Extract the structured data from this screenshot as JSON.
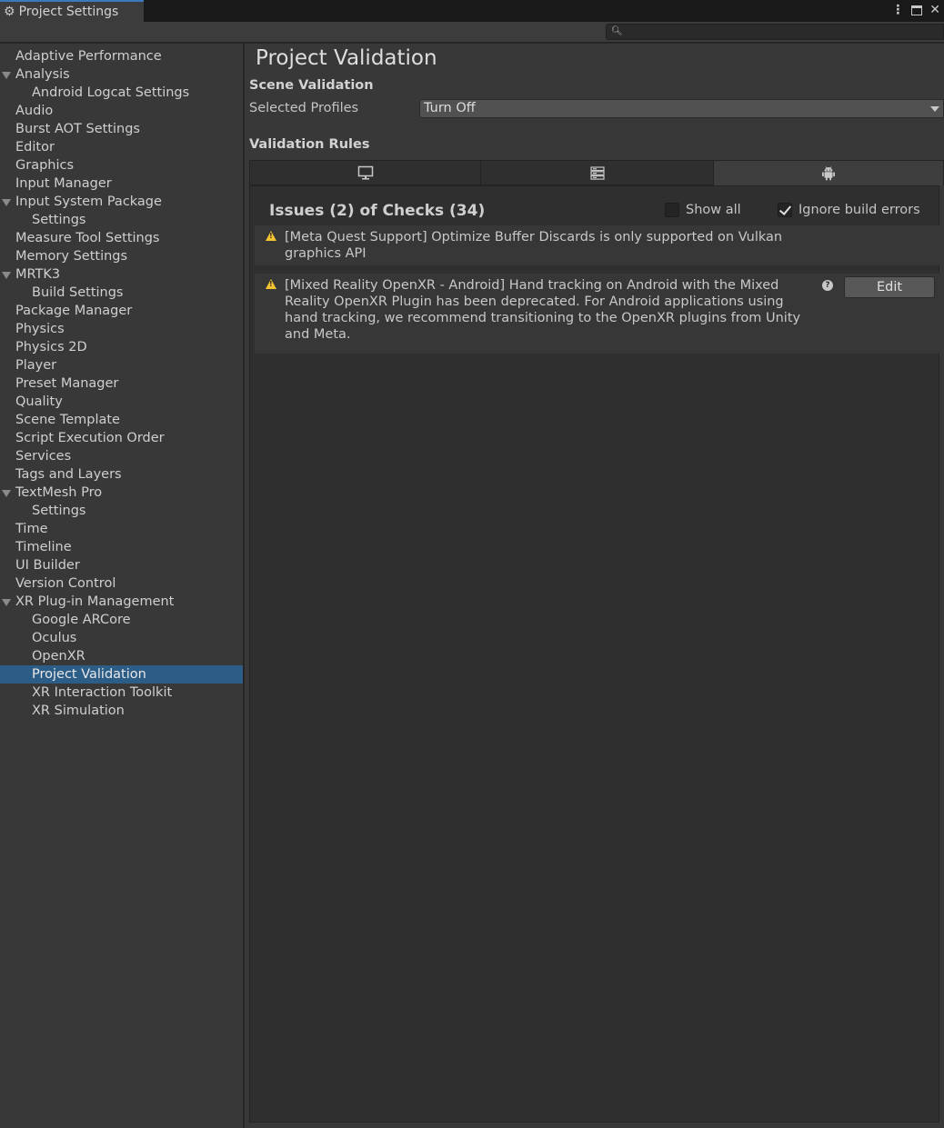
{
  "window": {
    "tab_title": "Project Settings",
    "tab_icon": "gear-icon",
    "controls": [
      "more-options-icon",
      "maximize-icon",
      "close-icon"
    ]
  },
  "search": {
    "placeholder": "",
    "value": ""
  },
  "sidebar": {
    "items": [
      {
        "label": "Adaptive Performance",
        "level": 0,
        "expandable": false
      },
      {
        "label": "Analysis",
        "level": 0,
        "expandable": true
      },
      {
        "label": "Android Logcat Settings",
        "level": 1,
        "expandable": false
      },
      {
        "label": "Audio",
        "level": 0,
        "expandable": false
      },
      {
        "label": "Burst AOT Settings",
        "level": 0,
        "expandable": false
      },
      {
        "label": "Editor",
        "level": 0,
        "expandable": false
      },
      {
        "label": "Graphics",
        "level": 0,
        "expandable": false
      },
      {
        "label": "Input Manager",
        "level": 0,
        "expandable": false
      },
      {
        "label": "Input System Package",
        "level": 0,
        "expandable": true
      },
      {
        "label": "Settings",
        "level": 1,
        "expandable": false
      },
      {
        "label": "Measure Tool Settings",
        "level": 0,
        "expandable": false
      },
      {
        "label": "Memory Settings",
        "level": 0,
        "expandable": false
      },
      {
        "label": "MRTK3",
        "level": 0,
        "expandable": true
      },
      {
        "label": "Build Settings",
        "level": 1,
        "expandable": false
      },
      {
        "label": "Package Manager",
        "level": 0,
        "expandable": false
      },
      {
        "label": "Physics",
        "level": 0,
        "expandable": false
      },
      {
        "label": "Physics 2D",
        "level": 0,
        "expandable": false
      },
      {
        "label": "Player",
        "level": 0,
        "expandable": false
      },
      {
        "label": "Preset Manager",
        "level": 0,
        "expandable": false
      },
      {
        "label": "Quality",
        "level": 0,
        "expandable": false
      },
      {
        "label": "Scene Template",
        "level": 0,
        "expandable": false
      },
      {
        "label": "Script Execution Order",
        "level": 0,
        "expandable": false
      },
      {
        "label": "Services",
        "level": 0,
        "expandable": false
      },
      {
        "label": "Tags and Layers",
        "level": 0,
        "expandable": false
      },
      {
        "label": "TextMesh Pro",
        "level": 0,
        "expandable": true
      },
      {
        "label": "Settings",
        "level": 1,
        "expandable": false
      },
      {
        "label": "Time",
        "level": 0,
        "expandable": false
      },
      {
        "label": "Timeline",
        "level": 0,
        "expandable": false
      },
      {
        "label": "UI Builder",
        "level": 0,
        "expandable": false
      },
      {
        "label": "Version Control",
        "level": 0,
        "expandable": false
      },
      {
        "label": "XR Plug-in Management",
        "level": 0,
        "expandable": true
      },
      {
        "label": "Google ARCore",
        "level": 1,
        "expandable": false
      },
      {
        "label": "Oculus",
        "level": 1,
        "expandable": false
      },
      {
        "label": "OpenXR",
        "level": 1,
        "expandable": false
      },
      {
        "label": "Project Validation",
        "level": 1,
        "expandable": false,
        "selected": true
      },
      {
        "label": "XR Interaction Toolkit",
        "level": 1,
        "expandable": false
      },
      {
        "label": "XR Simulation",
        "level": 1,
        "expandable": false
      }
    ]
  },
  "main": {
    "title": "Project Validation",
    "scene_validation": {
      "heading": "Scene Validation",
      "selected_profiles_label": "Selected Profiles",
      "selected_profiles_value": "Turn Off"
    },
    "validation_rules": {
      "heading": "Validation Rules",
      "platform_tabs": [
        {
          "icon": "desktop-icon",
          "active": false
        },
        {
          "icon": "server-icon",
          "active": false
        },
        {
          "icon": "android-icon",
          "active": true
        }
      ]
    },
    "issues": {
      "summary": "Issues (2) of Checks (34)",
      "show_all_label": "Show all",
      "show_all_checked": false,
      "ignore_build_errors_label": "Ignore build errors",
      "ignore_build_errors_checked": true,
      "list": [
        {
          "icon": "warning-icon",
          "text": "[Meta Quest Support] Optimize Buffer Discards is only supported on Vulkan graphics API"
        },
        {
          "icon": "warning-icon",
          "text": "[Mixed Reality OpenXR - Android] Hand tracking on Android with the Mixed Reality OpenXR Plugin has been deprecated. For Android applications using hand tracking, we recommend transitioning to the OpenXR plugins from Unity and Meta.",
          "help_icon": "help-icon",
          "edit_label": "Edit"
        }
      ]
    }
  },
  "colors": {
    "selection": "#2c5d87",
    "warning": "#f4c430",
    "panel_bg": "#383838"
  }
}
